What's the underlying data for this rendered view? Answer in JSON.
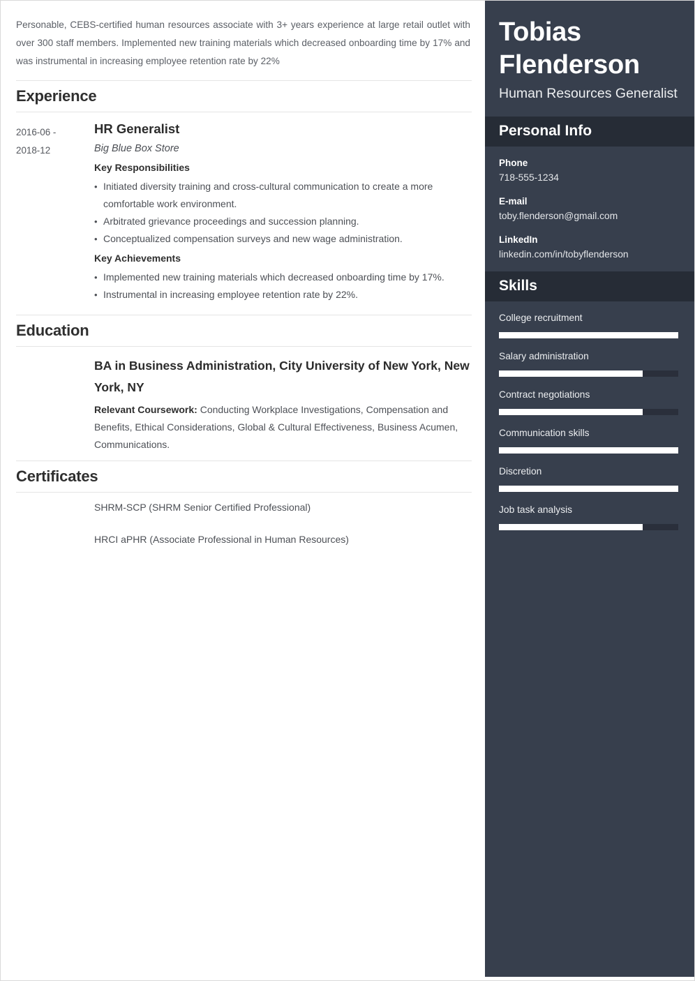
{
  "document": {
    "type": "resume",
    "accent_dark": "#373f4d",
    "accent_band": "#262c36",
    "bar_fill_color": "#ffffff",
    "bar_track_color": "#2a2f3b"
  },
  "summary": {
    "text": "Personable, CEBS-certified human resources associate with 3+ years experience at large retail outlet with over 300 staff members. Implemented new training materials which decreased onboarding time by 17% and was instrumental in increasing employee retention rate by 22%"
  },
  "experience": {
    "heading": "Experience",
    "entries": [
      {
        "dates": "2016-06 - 2018-12",
        "date_start": "2016-06 -",
        "date_end": "2018-12",
        "title": "HR Generalist",
        "company": "Big Blue Box Store",
        "responsibilities_label": "Key Responsibilities",
        "responsibilities": [
          "Initiated diversity training and cross-cultural communication to create a more comfortable work environment.",
          "Arbitrated grievance proceedings and succession planning.",
          "Conceptualized compensation surveys and new wage administration."
        ],
        "achievements_label": "Key Achievements",
        "achievements": [
          "Implemented new training materials which decreased onboarding time by 17%.",
          "Instrumental in increasing employee retention rate by 22%."
        ]
      }
    ]
  },
  "education": {
    "heading": "Education",
    "entries": [
      {
        "degree": "BA in Business Administration, City University of New York, New York, NY",
        "coursework_label": "Relevant Coursework:",
        "coursework": " Conducting Workplace Investigations, Compensation and Benefits, Ethical Considerations, Global & Cultural Effectiveness, Business Acumen, Communications."
      }
    ]
  },
  "certificates": {
    "heading": "Certificates",
    "items": [
      "SHRM-SCP (SHRM Senior Certified Professional)",
      "HRCI aPHR (Associate Professional in Human Resources)"
    ]
  },
  "sidebar": {
    "name": "Tobias Flenderson",
    "role": "Human Resources Generalist",
    "personal_info": {
      "heading": "Personal Info",
      "fields": [
        {
          "label": "Phone",
          "value": "718-555-1234"
        },
        {
          "label": "E-mail",
          "value": "toby.flenderson@gmail.com"
        },
        {
          "label": "LinkedIn",
          "value": "linkedin.com/in/tobyflenderson"
        }
      ]
    },
    "skills": {
      "heading": "Skills",
      "items": [
        {
          "name": "College recruitment",
          "level": 100
        },
        {
          "name": "Salary administration",
          "level": 80
        },
        {
          "name": "Contract negotiations",
          "level": 80
        },
        {
          "name": "Communication skills",
          "level": 100
        },
        {
          "name": "Discretion",
          "level": 100
        },
        {
          "name": "Job task analysis",
          "level": 80
        }
      ]
    }
  }
}
